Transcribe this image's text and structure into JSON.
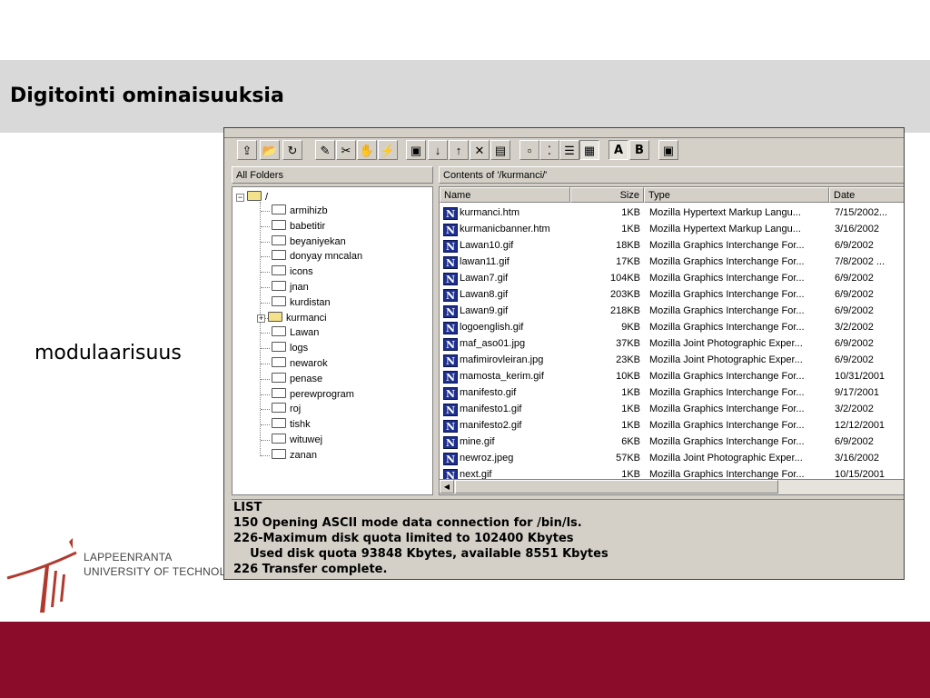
{
  "slide": {
    "title": "Digitointi ominaisuuksia",
    "side_label": "modulaarisuus"
  },
  "logo": {
    "line1": "LAPPEENRANTA",
    "line2": "UNIVERSITY OF TECHNOLOGY"
  },
  "colors": {
    "title_band": "#d9d9d9",
    "bottom_band": "#8b0b2a",
    "window_face": "#d4d0c8",
    "file_icon": "#1d2f8f"
  },
  "toolbar": {
    "buttons": [
      {
        "name": "folder-up-icon",
        "glyph": "⇪"
      },
      {
        "name": "open-folder-icon",
        "glyph": "📂"
      },
      {
        "name": "refresh-icon",
        "glyph": "↻"
      },
      {
        "name": "new-file-icon",
        "glyph": "✎"
      },
      {
        "name": "delete-file-icon",
        "glyph": "✂"
      },
      {
        "name": "hand-icon",
        "glyph": "✋"
      },
      {
        "name": "lightning-icon",
        "glyph": "⚡"
      },
      {
        "name": "save-icon",
        "glyph": "▣"
      },
      {
        "name": "download-arrow-icon",
        "glyph": "↓"
      },
      {
        "name": "upload-arrow-icon",
        "glyph": "↑"
      },
      {
        "name": "delete-x-icon",
        "glyph": "✕"
      },
      {
        "name": "properties-icon",
        "glyph": "▤"
      },
      {
        "name": "large-icons-view-icon",
        "glyph": "▫"
      },
      {
        "name": "small-icons-view-icon",
        "glyph": "⁚"
      },
      {
        "name": "list-view-icon",
        "glyph": "☰"
      },
      {
        "name": "details-view-icon",
        "glyph": "▦"
      },
      {
        "name": "ascii-mode-button",
        "glyph": "A"
      },
      {
        "name": "binary-mode-button",
        "glyph": "B"
      },
      {
        "name": "log-window-icon",
        "glyph": "▣"
      }
    ]
  },
  "folders_pane": {
    "header": "All Folders",
    "root": "/",
    "items": [
      {
        "label": "armihizb",
        "expandable": false,
        "open": false
      },
      {
        "label": "babetitir",
        "expandable": false,
        "open": false
      },
      {
        "label": "beyaniyekan",
        "expandable": false,
        "open": false
      },
      {
        "label": "donyay mncalan",
        "expandable": false,
        "open": false
      },
      {
        "label": "icons",
        "expandable": false,
        "open": false
      },
      {
        "label": "jnan",
        "expandable": false,
        "open": false
      },
      {
        "label": "kurdistan",
        "expandable": false,
        "open": false
      },
      {
        "label": "kurmanci",
        "expandable": true,
        "open": true
      },
      {
        "label": "Lawan",
        "expandable": false,
        "open": false
      },
      {
        "label": "logs",
        "expandable": false,
        "open": false
      },
      {
        "label": "newarok",
        "expandable": false,
        "open": false
      },
      {
        "label": "penase",
        "expandable": false,
        "open": false
      },
      {
        "label": "perewprogram",
        "expandable": false,
        "open": false
      },
      {
        "label": "roj",
        "expandable": false,
        "open": false
      },
      {
        "label": "tishk",
        "expandable": false,
        "open": false
      },
      {
        "label": "wituwej",
        "expandable": false,
        "open": false
      },
      {
        "label": "zanan",
        "expandable": false,
        "open": false
      }
    ]
  },
  "contents_pane": {
    "header": "Contents of '/kurmanci/'",
    "columns": [
      "Name",
      "Size",
      "Type",
      "Date"
    ],
    "rows": [
      {
        "name": "kurmanci.htm",
        "size": "1KB",
        "type": "Mozilla Hypertext Markup Langu...",
        "date": "7/15/2002..."
      },
      {
        "name": "kurmanicbanner.htm",
        "size": "1KB",
        "type": "Mozilla Hypertext Markup Langu...",
        "date": "3/16/2002"
      },
      {
        "name": "Lawan10.gif",
        "size": "18KB",
        "type": "Mozilla Graphics Interchange For...",
        "date": "6/9/2002"
      },
      {
        "name": "lawan11.gif",
        "size": "17KB",
        "type": "Mozilla Graphics Interchange For...",
        "date": "7/8/2002 ..."
      },
      {
        "name": "Lawan7.gif",
        "size": "104KB",
        "type": "Mozilla Graphics Interchange For...",
        "date": "6/9/2002"
      },
      {
        "name": "Lawan8.gif",
        "size": "203KB",
        "type": "Mozilla Graphics Interchange For...",
        "date": "6/9/2002"
      },
      {
        "name": "Lawan9.gif",
        "size": "218KB",
        "type": "Mozilla Graphics Interchange For...",
        "date": "6/9/2002"
      },
      {
        "name": "logoenglish.gif",
        "size": "9KB",
        "type": "Mozilla Graphics Interchange For...",
        "date": "3/2/2002"
      },
      {
        "name": "maf_aso01.jpg",
        "size": "37KB",
        "type": "Mozilla Joint Photographic Exper...",
        "date": "6/9/2002"
      },
      {
        "name": "mafimirovleiran.jpg",
        "size": "23KB",
        "type": "Mozilla Joint Photographic Exper...",
        "date": "6/9/2002"
      },
      {
        "name": "mamosta_kerim.gif",
        "size": "10KB",
        "type": "Mozilla Graphics Interchange For...",
        "date": "10/31/2001"
      },
      {
        "name": "manifesto.gif",
        "size": "1KB",
        "type": "Mozilla Graphics Interchange For...",
        "date": "9/17/2001"
      },
      {
        "name": "manifesto1.gif",
        "size": "1KB",
        "type": "Mozilla Graphics Interchange For...",
        "date": "3/2/2002"
      },
      {
        "name": "manifesto2.gif",
        "size": "1KB",
        "type": "Mozilla Graphics Interchange For...",
        "date": "12/12/2001"
      },
      {
        "name": "mine.gif",
        "size": "6KB",
        "type": "Mozilla Graphics Interchange For...",
        "date": "6/9/2002"
      },
      {
        "name": "newroz.jpeg",
        "size": "57KB",
        "type": "Mozilla Joint Photographic Exper...",
        "date": "3/16/2002"
      },
      {
        "name": "next.gif",
        "size": "1KB",
        "type": "Mozilla Graphics Interchange For...",
        "date": "10/15/2001"
      }
    ]
  },
  "log": {
    "lines": [
      "LIST",
      "150 Opening ASCII mode data connection for /bin/ls.",
      "226-Maximum disk quota limited to 102400 Kbytes",
      "    Used disk quota 93848 Kbytes, available 8551 Kbytes",
      "226 Transfer complete."
    ]
  }
}
